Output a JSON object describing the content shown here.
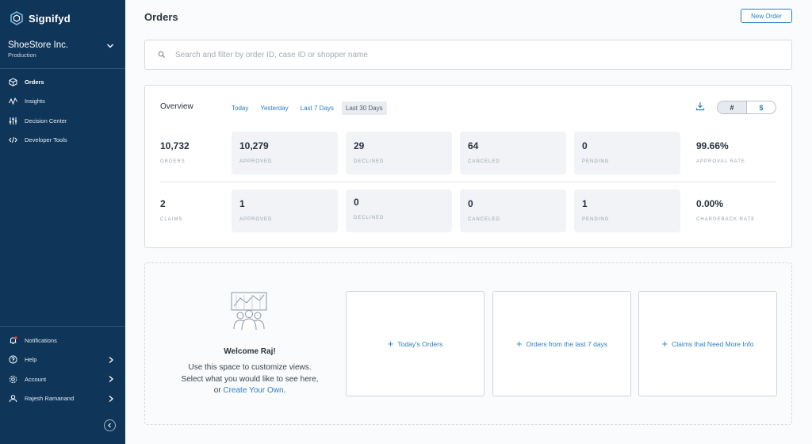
{
  "app": {
    "name": "Signifyd"
  },
  "store": {
    "name": "ShoeStore Inc.",
    "environment": "Production"
  },
  "nav": {
    "primary": [
      {
        "label": "Orders",
        "icon": "box-icon",
        "active": true
      },
      {
        "label": "Insights",
        "icon": "insights-icon"
      },
      {
        "label": "Decision Center",
        "icon": "sliders-icon"
      },
      {
        "label": "Developer Tools",
        "icon": "code-icon"
      }
    ],
    "secondary": [
      {
        "label": "Notifications",
        "icon": "bell-icon"
      },
      {
        "label": "Help",
        "icon": "help-icon"
      },
      {
        "label": "Account",
        "icon": "gear-icon"
      },
      {
        "label": "Rajesh Ramanand",
        "icon": "user-icon"
      }
    ]
  },
  "header": {
    "title": "Orders",
    "new_order_label": "New Order"
  },
  "search": {
    "placeholder": "Search and filter by order ID, case ID or shopper name",
    "value": ""
  },
  "overview": {
    "title": "Overview",
    "ranges": [
      "Today",
      "Yesterday",
      "Last 7 Days",
      "Last 30 Days"
    ],
    "selected_range": "Last 30 Days",
    "toggle": {
      "count": "#",
      "currency": "$",
      "selected": "#"
    },
    "orders_row": [
      {
        "value": "10,732",
        "label": "Orders"
      },
      {
        "value": "10,279",
        "label": "Approved"
      },
      {
        "value": "29",
        "label": "Declined"
      },
      {
        "value": "64",
        "label": "Canceled"
      },
      {
        "value": "0",
        "label": "Pending"
      },
      {
        "value": "99.66%",
        "label": "Approval Rate"
      }
    ],
    "claims_row": [
      {
        "value": "2",
        "label": "Claims"
      },
      {
        "value": "1",
        "label": "Approved"
      },
      {
        "value": "0",
        "label": "Declined"
      },
      {
        "value": "0",
        "label": "Canceled"
      },
      {
        "value": "1",
        "label": "Pending"
      },
      {
        "value": "0.00%",
        "label": "Chargeback Rate"
      }
    ]
  },
  "welcome": {
    "title": "Welcome Raj!",
    "line1": "Use this space to customize views.",
    "line2": "Select what you would like to see here,",
    "line3_prefix": "or ",
    "create_link": "Create Your Own",
    "line3_suffix": "."
  },
  "views": [
    {
      "label": "Today's Orders"
    },
    {
      "label": "Orders from the last 7 days"
    },
    {
      "label": "Claims that Need More Info"
    }
  ],
  "colors": {
    "sidebar": "#0f3559",
    "accent": "#2e7fbf",
    "notification_dot": "#e0403a"
  }
}
